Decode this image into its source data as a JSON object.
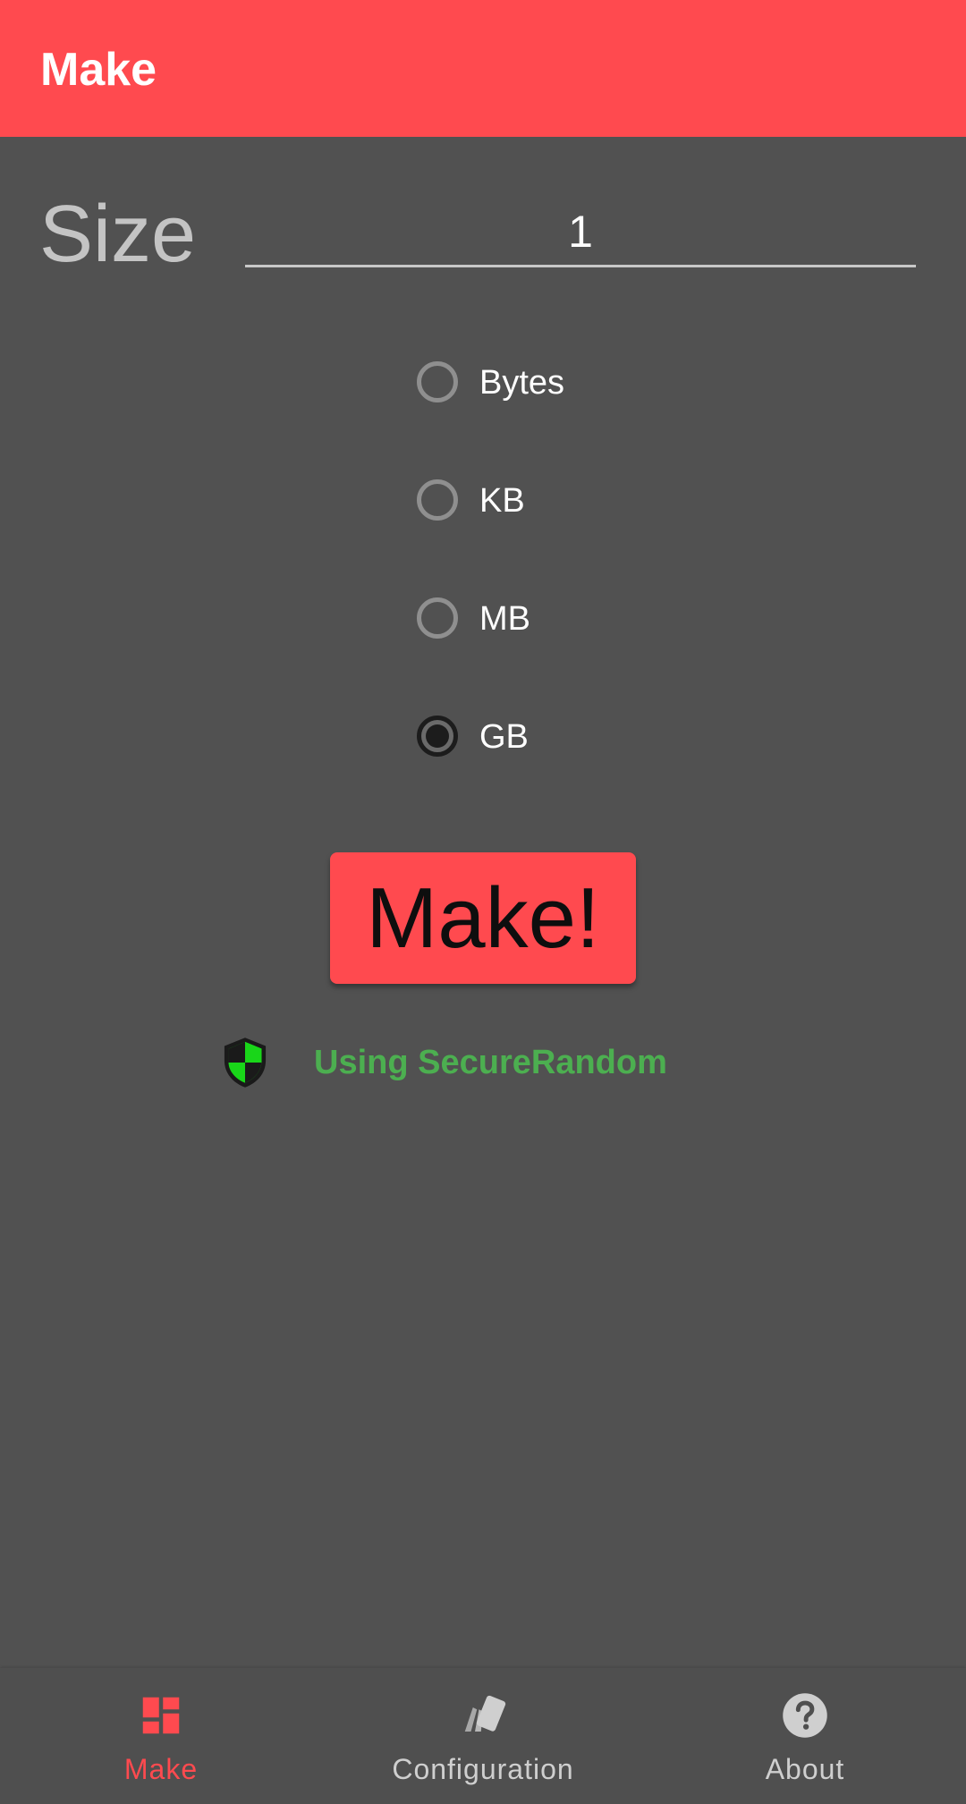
{
  "appbar": {
    "title": "Make",
    "color": "#ff4a4f"
  },
  "size": {
    "label": "Size",
    "value": "1"
  },
  "units": {
    "options": [
      "Bytes",
      "KB",
      "MB",
      "GB"
    ],
    "selected": "GB"
  },
  "make_button": {
    "label": "Make!"
  },
  "status": {
    "icon": "shield-icon",
    "text": "Using SecureRandom",
    "color": "#4caf50"
  },
  "bottom_nav": {
    "items": [
      {
        "label": "Make",
        "icon": "dashboard-icon",
        "active": true
      },
      {
        "label": "Configuration",
        "icon": "cards-icon",
        "active": false
      },
      {
        "label": "About",
        "icon": "help-icon",
        "active": false
      }
    ]
  }
}
